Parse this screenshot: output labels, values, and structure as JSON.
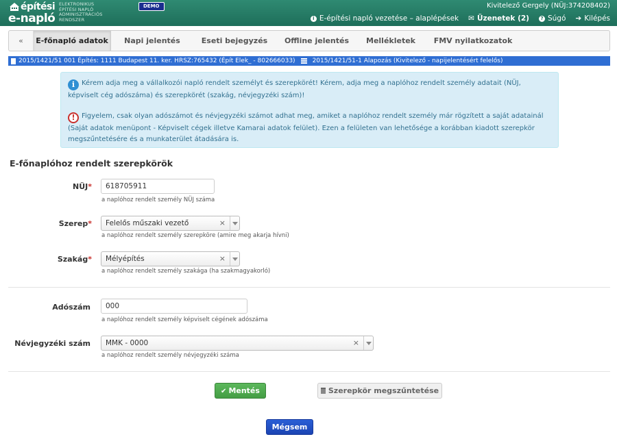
{
  "header": {
    "logo_top": "építési",
    "logo_bottom": "e-napló",
    "logo_sub": [
      "ELEKTRONIKUS",
      "ÉPÍTÉSI NAPLÓ",
      "ADMINISZTRÁCIÓS",
      "RENDSZER"
    ],
    "demo_badge": "DEMO",
    "user": "Kivitelező Gergely (NÜJ:374208402)",
    "links": {
      "guide": "E-építési napló vezetése – alaplépések",
      "messages": "Üzenetek (2)",
      "help": "Súgó",
      "logout": "Kilépés"
    }
  },
  "tabs": {
    "back": "«",
    "items": [
      "E-főnapló adatok",
      "Napi jelentés",
      "Eseti bejegyzés",
      "Offline jelentés",
      "Mellékletek",
      "FMV nyilatkozatok"
    ]
  },
  "breadcrumb": {
    "project": "2015/1421/51 001 Építés: 1111 Budapest 11. ker. HRSZ:765432 (Épít Elek_ - 802666033)",
    "diary": "2015/1421/51-1 Alapozás (Kivitelező - napijelentésért felelős)"
  },
  "alert": {
    "info": "Kérem adja meg a vállalkozói napló rendelt személyt és szerepkörét! Kérem, adja meg a naplóhoz rendelt személy adatait (NÜJ, képviselt cég adószáma) és szerepkörét (szakág, névjegyzéki szám)!",
    "warning": "Figyelem, csak olyan adószámot és névjegyzéki számot adhat meg, amiket a naplóhoz rendelt személy már rögzített a saját adatainál (Saját adatok menüpont - Képviselt cégek illetve Kamarai adatok felület). Ezen a felületen van lehetősége a korábban kiadott szerepkör megszűntetésére és a munkaterület átadására is."
  },
  "form": {
    "title": "E-főnaplóhoz rendelt szerepkörök",
    "nuj": {
      "label": "NÜJ",
      "value": "618705911",
      "help": "a naplóhoz rendelt személy NÜJ száma"
    },
    "szerep": {
      "label": "Szerep",
      "value": "Felelős műszaki vezető",
      "help": "a naplóhoz rendelt személy szerepköre (amire meg akarja hívni)"
    },
    "szakag": {
      "label": "Szakág",
      "value": "Mélyépítés",
      "help": "a naplóhoz rendelt személy szakága (ha szakmagyakorló)"
    },
    "adoszam": {
      "label": "Adószám",
      "value": "000",
      "help": "a naplóhoz rendelt személy képviselt cégének adószáma"
    },
    "nevjegyzek": {
      "label": "Névjegyzéki szám",
      "value": "MMK - 0000",
      "help": "a naplóhoz rendelt személy névjegyzéki száma"
    },
    "required_mark": "*",
    "clear_mark": "×"
  },
  "buttons": {
    "save": "Mentés",
    "revoke": "Szerepkör megszűntetése",
    "cancel": "Mégsem"
  }
}
